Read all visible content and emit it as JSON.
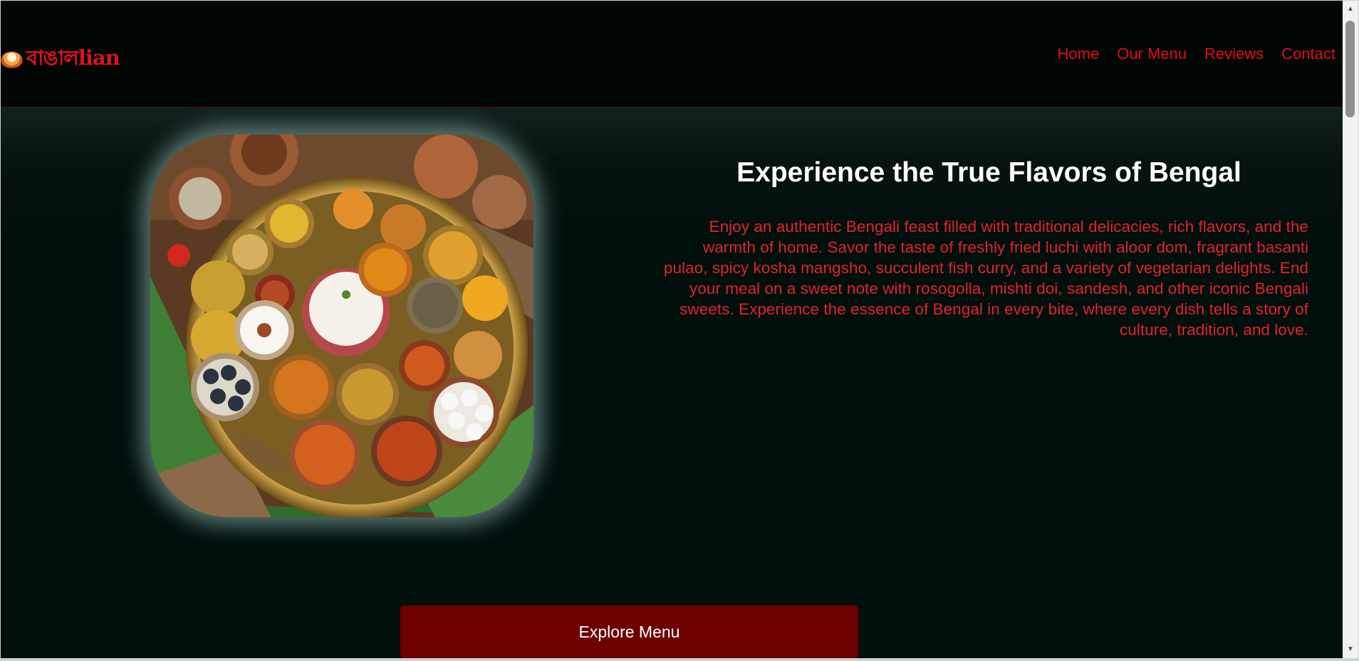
{
  "brand": {
    "logo_text": "বাঙালlian",
    "logo_icon": "curry-bowl-icon",
    "color": "#e0121c"
  },
  "nav": {
    "items": [
      "Home",
      "Our Menu",
      "Reviews",
      "Contact"
    ]
  },
  "hero": {
    "title": "Experience the True Flavors of Bengal",
    "description": "Enjoy an authentic Bengali feast filled with traditional delicacies, rich flavors, and the warmth of home. Savor the taste of freshly fried luchi with aloor dom, fragrant basanti pulao, spicy kosha mangsho, succulent fish curry, and a variety of vegetarian delights. End your meal on a sweet note with rosogolla, mishti doi, sandesh, and other iconic Bengali sweets. Experience the essence of Bengal in every bite, where every dish tells a story of culture, tradition, and love.",
    "image": "bengali-thali-image",
    "cta_label": "Explore Menu"
  },
  "colors": {
    "background": "#010f0d",
    "navbar": "#020605",
    "accent_red": "#e20d18",
    "button": "#6e0000"
  }
}
